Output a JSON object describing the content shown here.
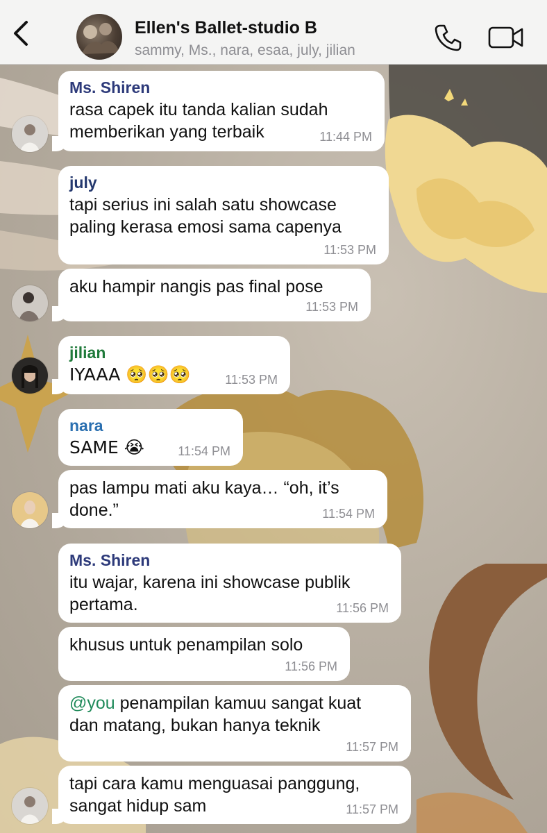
{
  "header": {
    "title": "Ellen's Ballet-studio B",
    "members": "sammy, Ms., nara, esaa, july, jilian"
  },
  "colors": {
    "shiren": "#2d3a7a",
    "july": "#24386e",
    "jilian": "#1f7a3a",
    "nara": "#2a6fb0",
    "mention": "#1f8a5a"
  },
  "messages": [
    {
      "sender": "Ms. Shiren",
      "text": "rasa capek itu tanda kalian sudah\nmemberikan yang terbaik",
      "time": "11:44 PM"
    },
    {
      "sender": "july",
      "text": "tapi serius ini salah satu showcase\npaling kerasa emosi sama capenya",
      "time": "11:53 PM"
    },
    {
      "sender": "",
      "text": "aku hampir nangis pas final pose",
      "time": "11:53 PM"
    },
    {
      "sender": "jilian",
      "text": "IYAAA 🥺🥺🥺",
      "time": "11:53 PM"
    },
    {
      "sender": "nara",
      "text": "SAME 😭",
      "time": "11:54 PM"
    },
    {
      "sender": "",
      "text": "pas lampu mati aku kaya… “oh, it’s\ndone.”",
      "time": "11:54 PM"
    },
    {
      "sender": "Ms. Shiren",
      "text": "itu wajar, karena ini showcase publik\npertama.",
      "time": "11:56 PM"
    },
    {
      "sender": "",
      "text": "khusus untuk penampilan solo",
      "time": "11:56 PM"
    },
    {
      "sender": "",
      "mention": "@you",
      "text": " penampilan kamuu sangat kuat\ndan matang, bukan hanya teknik",
      "time": "11:57 PM"
    },
    {
      "sender": "",
      "text": "tapi cara kamu menguasai panggung,\nsangat hidup sam",
      "time": "11:57 PM"
    }
  ]
}
